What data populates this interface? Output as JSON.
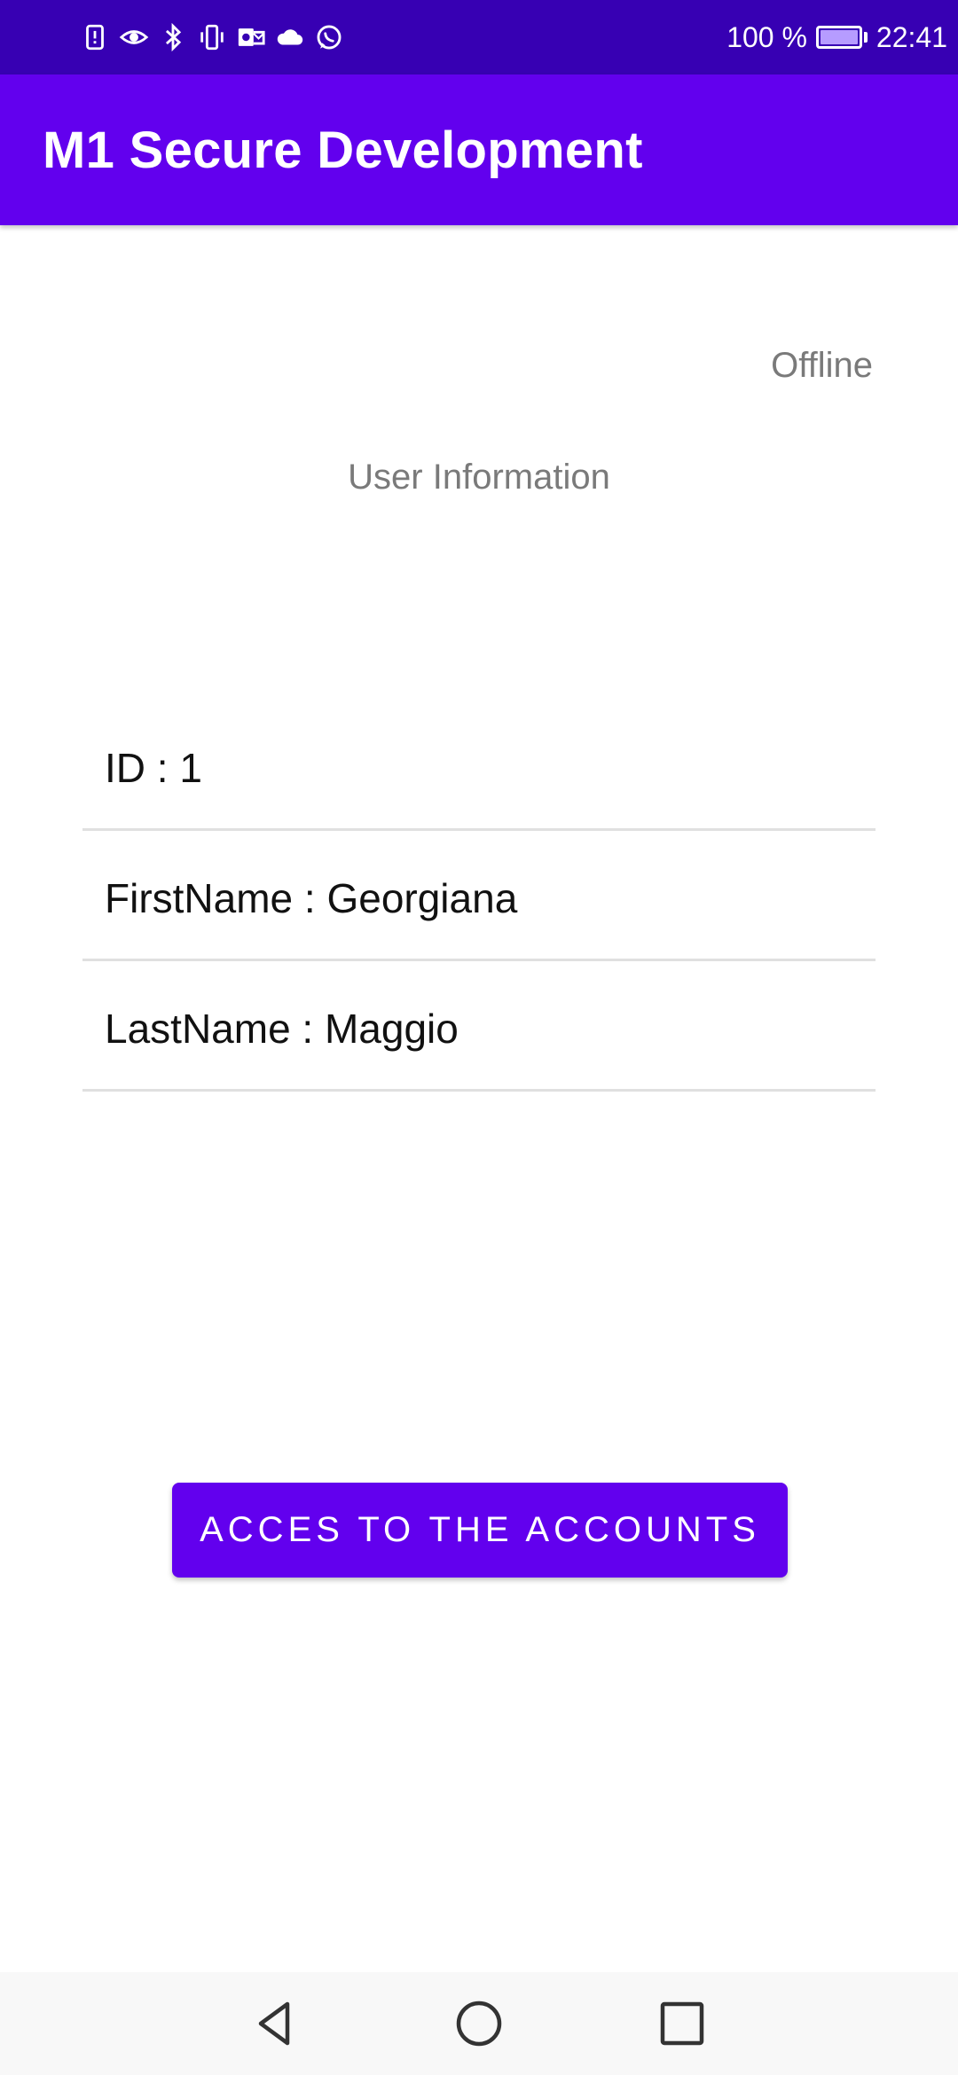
{
  "status_bar": {
    "icons": [
      "sim-alert-icon",
      "eye-icon",
      "bluetooth-icon",
      "vibrate-icon",
      "outlook-icon",
      "cloud-icon",
      "whatsapp-icon"
    ],
    "battery_percent": "100 %",
    "battery_level": 1.0,
    "battery_color": "#b69cff",
    "time": "22:41",
    "background": "#3700b3"
  },
  "app_bar": {
    "title": "M1 Secure Development",
    "background": "#6200ee"
  },
  "main": {
    "connection_status": "Offline",
    "section_title": "User Information",
    "info_rows": [
      {
        "text": "ID : 1"
      },
      {
        "text": "FirstName : Georgiana"
      },
      {
        "text": "LastName : Maggio"
      }
    ],
    "accounts_button_label": "ACCES TO THE ACCOUNTS",
    "accent": "#6200ee"
  },
  "nav_bar": {
    "buttons": [
      "back-icon",
      "home-icon",
      "recents-icon"
    ]
  }
}
